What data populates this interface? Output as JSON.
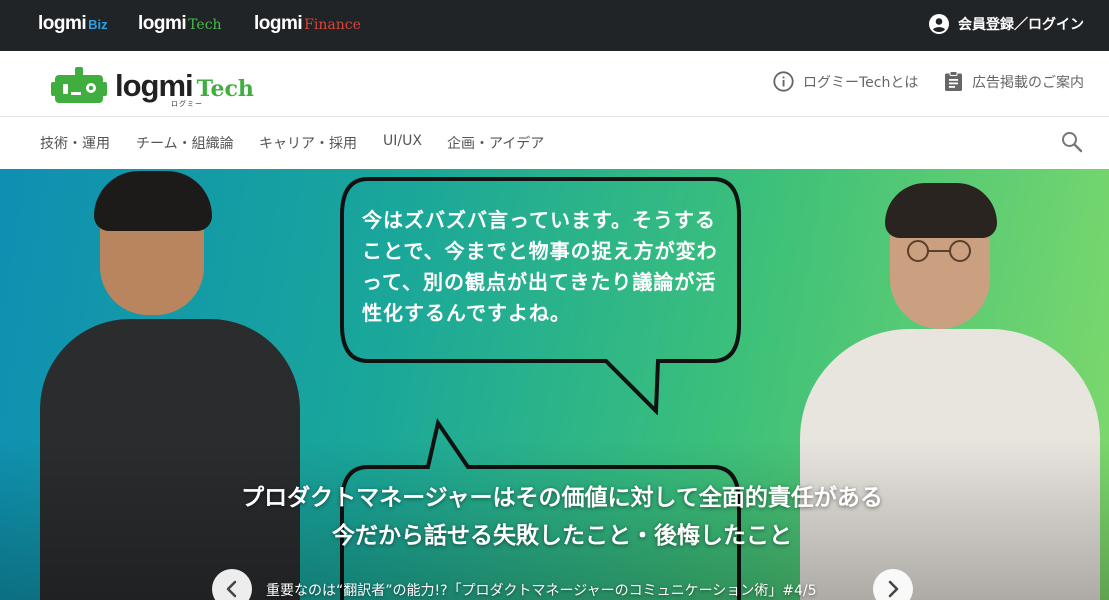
{
  "topbar": {
    "brands": [
      {
        "logo": "logmi",
        "suffix": "Biz",
        "color": "#2f9fe0"
      },
      {
        "logo": "logmi",
        "suffix": "Tech",
        "color": "#48b94b"
      },
      {
        "logo": "logmi",
        "suffix": "Finance",
        "color": "#d94338"
      }
    ],
    "login_label": "会員登録／ログイン",
    "login_icon": "account-circle-icon"
  },
  "header": {
    "logo_main": "logmi",
    "logo_tech": "Tech",
    "logo_sub": "ログミー",
    "about_label": "ログミーTechとは",
    "about_icon": "info-icon",
    "ad_label": "広告掲載のご案内",
    "ad_icon": "clipboard-icon",
    "brand_color": "#3fae3f"
  },
  "nav": {
    "categories": [
      "技術・運用",
      "チーム・組織論",
      "キャリア・採用",
      "UI/UX",
      "企画・アイデア"
    ],
    "search_icon": "search-icon"
  },
  "hero": {
    "bubble_text": "今はズバズバ言っています。そうすることで、今までと物事の捉え方が変わって、別の観点が出てきたり議論が活性化するんですよね。",
    "title_line1": "プロダクトマネージャーはその価値に対して全面的責任がある",
    "title_line2": "今だから話せる失敗したこと・後悔したこと",
    "subtitle": "重要なのは“翻訳者”の能力!?「プロダクトマネージャーのコミュニケーション術」#4/5",
    "prev_icon": "chevron-left-icon",
    "next_icon": "chevron-right-icon"
  }
}
